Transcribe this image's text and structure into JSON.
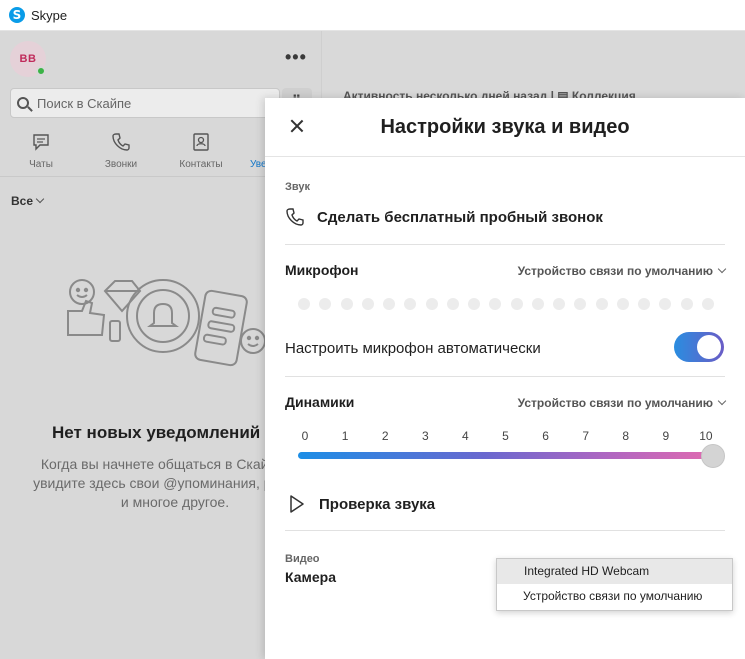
{
  "window": {
    "title": "Skype",
    "logo_letter": "S"
  },
  "user": {
    "initials": "BB"
  },
  "sidebar": {
    "more_label": "•••",
    "search_placeholder": "Поиск в Скайпе",
    "dialpad_label": "⠿",
    "nav": [
      {
        "label": "Чаты"
      },
      {
        "label": "Звонки"
      },
      {
        "label": "Контакты"
      },
      {
        "label": "Уве"
      }
    ],
    "filter_label": "Все",
    "empty_title": "Нет новых уведомлений",
    "empty_desc": "Когда вы начнете общаться в Скайпе, вы увидите здесь свои @упоминания, реакции и многое другое."
  },
  "main": {
    "header_text": "Активность несколько дней назад  |  ▤ Коллекция"
  },
  "modal": {
    "title": "Настройки звука и видео",
    "audio_section": "Звук",
    "test_call": "Сделать бесплатный пробный звонок",
    "microphone_label": "Микрофон",
    "microphone_device": "Устройство связи по умолчанию",
    "mic_level_dots": 20,
    "auto_mic_label": "Настроить микрофон автоматически",
    "auto_mic_enabled": true,
    "speakers_label": "Динамики",
    "speakers_device": "Устройство связи по умолчанию",
    "volume_scale": [
      "0",
      "1",
      "2",
      "3",
      "4",
      "5",
      "6",
      "7",
      "8",
      "9",
      "10"
    ],
    "volume_value": 10,
    "sound_check": "Проверка звука",
    "video_section": "Видео",
    "camera_label": "Камера",
    "camera_options": [
      "Integrated HD Webcam",
      "Устройство связи по умолчанию"
    ],
    "camera_selected": "Integrated HD Webcam"
  },
  "colors": {
    "skype_blue": "#0a9ce8",
    "accent_blue": "#1277c9",
    "online_green": "#3bb346",
    "avatar_pink": "#c02b5b"
  }
}
